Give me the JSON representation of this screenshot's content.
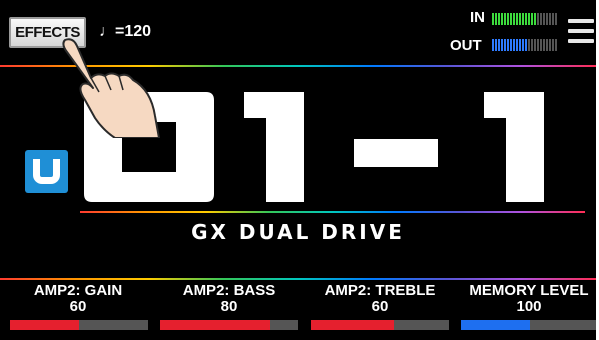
{
  "header": {
    "effects_label": "EFFECTS",
    "tempo": "♩=120",
    "in_label": "IN",
    "out_label": "OUT"
  },
  "meters": {
    "in_level": 0.7,
    "out_level": 0.55,
    "in_color": "#3ddc3d",
    "out_color": "#2e7bff"
  },
  "patch": {
    "bank_icon": "user-bank-icon",
    "number": "01-1",
    "name": "GX DUAL DRIVE"
  },
  "knobs": [
    {
      "label": "AMP2: GAIN",
      "value": "60",
      "level": 0.5,
      "color": "#e5202e"
    },
    {
      "label": "AMP2: BASS",
      "value": "80",
      "level": 0.8,
      "color": "#e5202e"
    },
    {
      "label": "AMP2: TREBLE",
      "value": "60",
      "level": 0.6,
      "color": "#e5202e"
    },
    {
      "label": "MEMORY LEVEL",
      "value": "100",
      "level": 0.5,
      "color": "#1e6ff0"
    }
  ],
  "colors": {
    "background": "#000000",
    "accent_blue": "#1f8fd6"
  }
}
